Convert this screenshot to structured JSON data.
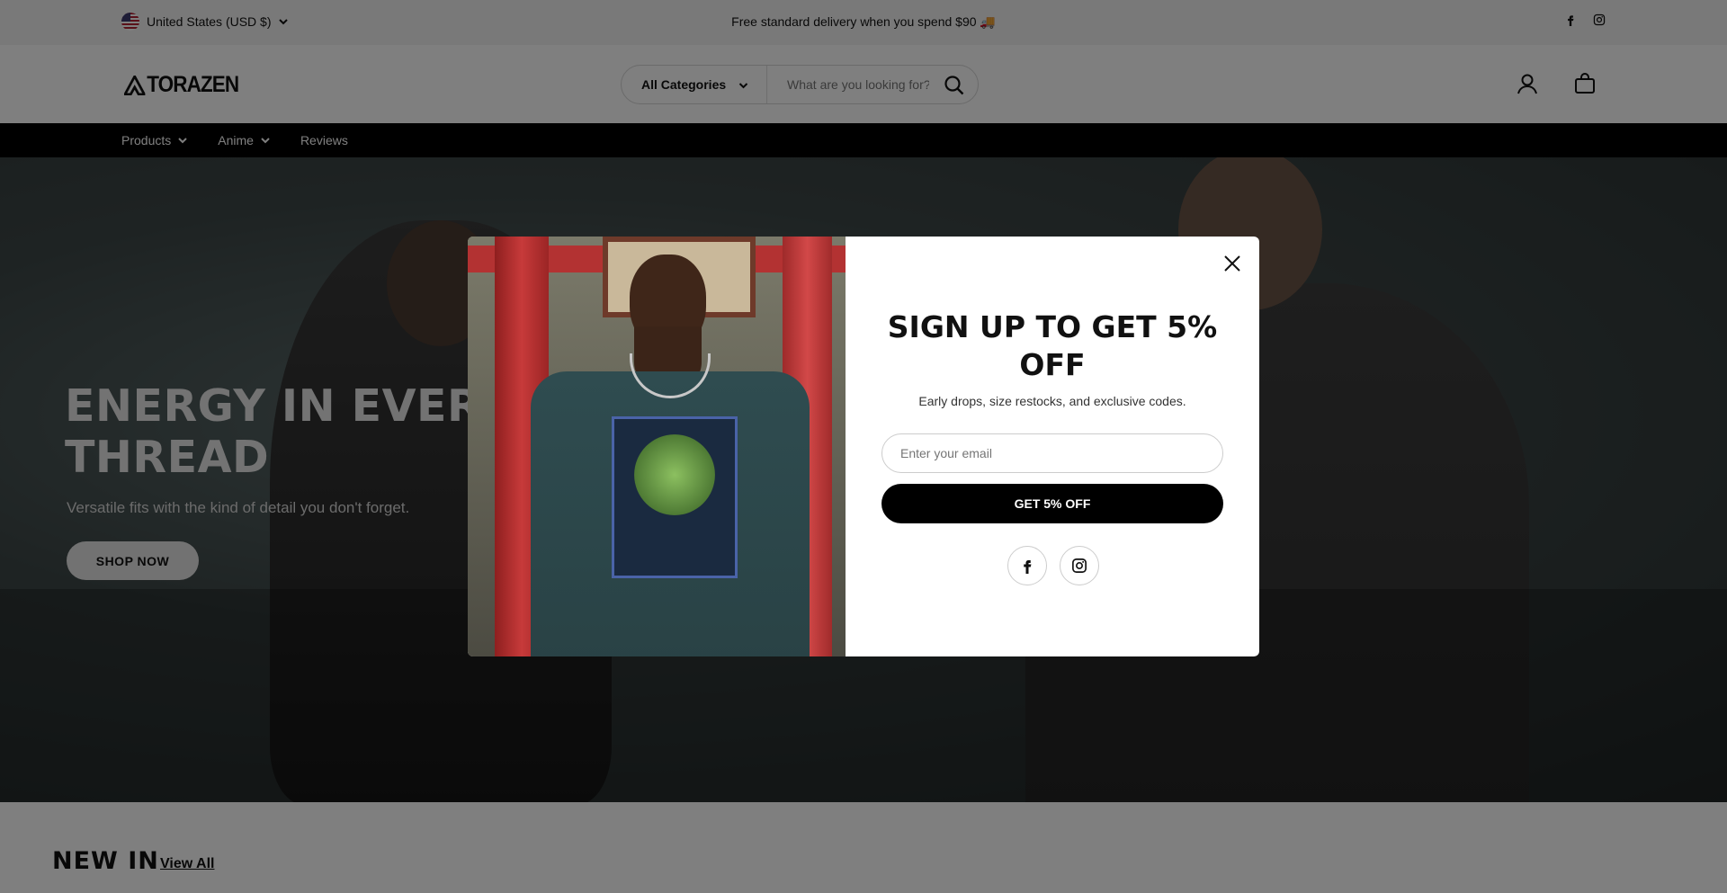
{
  "announcement": {
    "currency": "United States (USD $)",
    "message": "Free standard delivery when you spend $90 🚚"
  },
  "header": {
    "logo_text": "TORAZEN",
    "search": {
      "category": "All Categories",
      "placeholder": "What are you looking for?"
    }
  },
  "nav": {
    "items": [
      {
        "label": "Products"
      },
      {
        "label": "Anime"
      },
      {
        "label": "Reviews"
      }
    ]
  },
  "hero": {
    "title": "ENERGY IN EVERY THREAD",
    "subtitle": "Versatile fits with the kind of detail you don't forget.",
    "cta": "SHOP NOW"
  },
  "section": {
    "title": "NEW IN",
    "link": "View All"
  },
  "modal": {
    "title": "SIGN UP TO GET 5% OFF",
    "subtitle": "Early drops, size restocks, and exclusive codes.",
    "email_placeholder": "Enter your email",
    "submit": "GET 5% OFF"
  }
}
